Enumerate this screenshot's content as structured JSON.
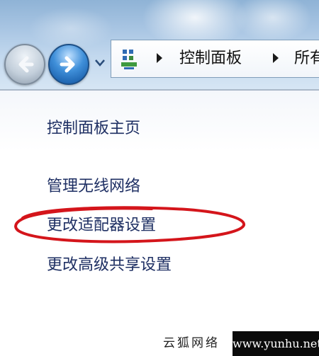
{
  "address_bar": {
    "breadcrumbs": [
      "控制面板",
      "所有"
    ],
    "icon": "control-panel-icon"
  },
  "navigation": {
    "back_icon": "back-arrow-icon",
    "forward_icon": "forward-arrow-icon",
    "history_icon": "chevron-down-icon"
  },
  "task_pane": {
    "links": [
      "控制面板主页",
      "管理无线网络",
      "更改适配器设置",
      "更改高级共享设置"
    ]
  },
  "annotation": {
    "color": "#d4151b",
    "target": "更改适配器设置"
  },
  "watermark": {
    "left_text": "云狐网络",
    "right_text": "www.yunhu.net"
  }
}
